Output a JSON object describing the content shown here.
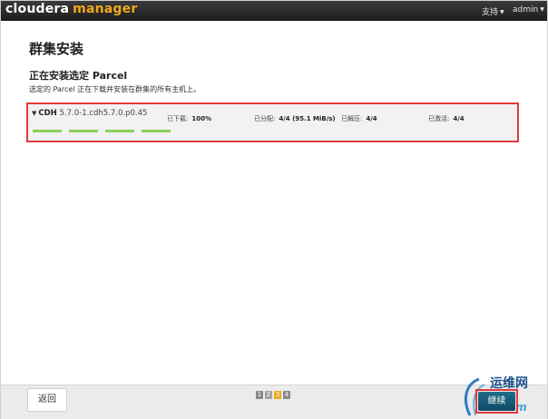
{
  "nav": {
    "brand_main": "cloudera",
    "brand_sub": "manager",
    "support_label": "支持",
    "user_label": "admin"
  },
  "page": {
    "title": "群集安装",
    "section_title": "正在安装选定 Parcel",
    "section_subtitle": "选定的 Parcel 正在下载并安装在群集的所有主机上。"
  },
  "parcel": {
    "name_bold": "CDH",
    "name_version": "5.7.0-1.cdh5.7.0.p0.45",
    "stages": [
      {
        "label": "已下载:",
        "value": "100%",
        "progress": 1.0
      },
      {
        "label": "已分配:",
        "value": "4/4 (95.1 MiB/s)",
        "progress": 1.0
      },
      {
        "label": "已解压:",
        "value": "4/4",
        "progress": 1.0
      },
      {
        "label": "已激活:",
        "value": "4/4",
        "progress": 1.0
      }
    ],
    "host_bars": 4,
    "colors": {
      "bar": "#0f5b76",
      "host_bar": "#8bd05a",
      "highlight": "#e23a3a"
    }
  },
  "footer": {
    "back_label": "返回",
    "continue_label": "继续",
    "steps": [
      "1",
      "2",
      "3",
      "4"
    ],
    "current_step": "3"
  },
  "watermark": {
    "line1": "运维网",
    "line2": "om"
  }
}
